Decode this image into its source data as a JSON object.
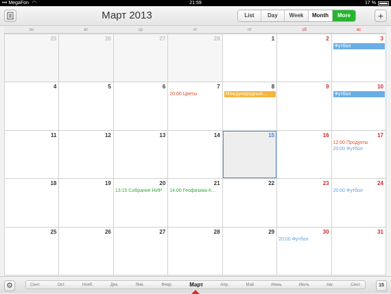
{
  "status": {
    "carrier": "MegaFon",
    "time": "21:59",
    "battery": "17 %"
  },
  "header": {
    "title": "Март 2013",
    "views": [
      "List",
      "Day",
      "Week",
      "Month",
      "More"
    ],
    "active_view": "Month"
  },
  "weekdays": [
    "пн",
    "вт",
    "ср",
    "чт",
    "пт",
    "сб",
    "вс"
  ],
  "weeks": [
    [
      {
        "day": "25",
        "other": true
      },
      {
        "day": "26",
        "other": true
      },
      {
        "day": "27",
        "other": true
      },
      {
        "day": "28",
        "other": true
      },
      {
        "day": "1"
      },
      {
        "day": "2",
        "weekend": true
      },
      {
        "day": "3",
        "weekend": true,
        "events": [
          {
            "text": "Футбол",
            "kind": "bar",
            "color": "#6aaee6"
          }
        ]
      }
    ],
    [
      {
        "day": "4"
      },
      {
        "day": "5"
      },
      {
        "day": "6"
      },
      {
        "day": "7",
        "events": [
          {
            "text": "20:00 Цветы",
            "kind": "text",
            "color": "#e0502a"
          }
        ]
      },
      {
        "day": "8",
        "events": [
          {
            "text": "Международный…",
            "kind": "bar",
            "color": "#f5b53a"
          }
        ]
      },
      {
        "day": "9",
        "weekend": true
      },
      {
        "day": "10",
        "weekend": true,
        "events": [
          {
            "text": "Футбол",
            "kind": "bar",
            "color": "#6aaee6"
          }
        ]
      }
    ],
    [
      {
        "day": "11"
      },
      {
        "day": "12"
      },
      {
        "day": "13"
      },
      {
        "day": "14"
      },
      {
        "day": "15",
        "today": true
      },
      {
        "day": "16",
        "weekend": true
      },
      {
        "day": "17",
        "weekend": true,
        "events": [
          {
            "text": "12:00 Продукты",
            "kind": "text",
            "color": "#e0502a"
          },
          {
            "text": "20:00 Футбол",
            "kind": "text",
            "color": "#5a9fe0"
          }
        ]
      }
    ],
    [
      {
        "day": "18"
      },
      {
        "day": "19"
      },
      {
        "day": "20",
        "events": [
          {
            "text": "13:15 Собрание НИР",
            "kind": "text",
            "color": "#3aa63a"
          }
        ]
      },
      {
        "day": "21",
        "events": [
          {
            "text": "14:00 Геофизика-К…",
            "kind": "text",
            "color": "#3aa63a"
          }
        ]
      },
      {
        "day": "22"
      },
      {
        "day": "23",
        "weekend": true
      },
      {
        "day": "24",
        "weekend": true,
        "events": [
          {
            "text": "20:00 Футбол",
            "kind": "text",
            "color": "#5a9fe0"
          }
        ]
      }
    ],
    [
      {
        "day": "25"
      },
      {
        "day": "26"
      },
      {
        "day": "27"
      },
      {
        "day": "28"
      },
      {
        "day": "29"
      },
      {
        "day": "30",
        "weekend": true,
        "events": [
          {
            "text": "20:00 Футбол",
            "kind": "text",
            "color": "#5a9fe0"
          }
        ]
      },
      {
        "day": "31",
        "weekend": true
      }
    ]
  ],
  "footer": {
    "months": [
      "Сент.",
      "Окт.",
      "Нояб.",
      "Дек.",
      "Янв.",
      "Февр.",
      "Март",
      "Апр.",
      "Май",
      "Июнь",
      "Июль",
      "Авг.",
      "Сент."
    ],
    "current_month": "Март",
    "today_day": "15"
  }
}
